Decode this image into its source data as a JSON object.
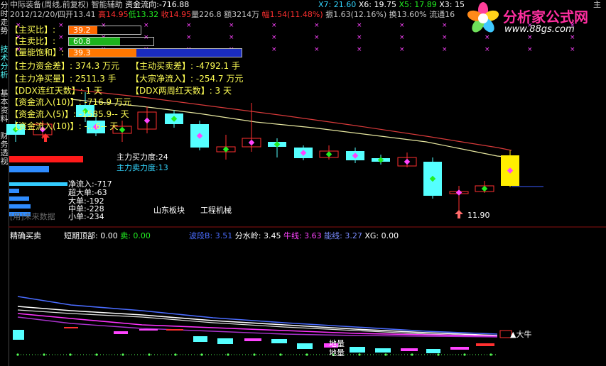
{
  "sidebar": {
    "tabs": [
      {
        "label": "分时走势"
      },
      {
        "label": "技术分析"
      },
      {
        "label": "基本资料"
      },
      {
        "label": "财务透视"
      }
    ]
  },
  "header": {
    "title": "中际装备(周线,前复权)",
    "indicator": "智能辅助",
    "flow_label": "资金流向:",
    "flow_value": "-716.88",
    "x7": "X7: 21.60",
    "x6": "X6: 19.75",
    "x5": "X5: 17.89",
    "x3": "X3: 15",
    "date": "2012/12/20/四",
    "open": "开13.41",
    "high": "高14.95",
    "low": "低13.32",
    "close": "收14.95",
    "volume": "量226.8",
    "amount": "额3214万",
    "change": "幅1.54(11.48%)",
    "amplitude": "振1.63(12.16%)",
    "turnover": "换13.60%",
    "float": "流通16",
    "right_note": "主"
  },
  "watermark": {
    "brand": "分析家公式网",
    "url": "www.88gs.com"
  },
  "ratio_bars": [
    {
      "label": "【主买比】:",
      "value": "39.2",
      "fill": 0.392,
      "color": "#ff6a00"
    },
    {
      "label": "【主卖比】:",
      "value": "60.8",
      "fill": 0.608,
      "color": "#1db31d"
    },
    {
      "label": "【量能饱和】:",
      "value": "39.3",
      "fill": 0.393,
      "color": "#ff7700",
      "rest_color": "#1a2cbf"
    }
  ],
  "stats": {
    "main_fund_diff": "【主力资金差】: 374.3 万元",
    "active_buy_diff": "【主动买卖差】: -4792.1 手",
    "main_net_buy": "【主力净买量】: 2511.3 手",
    "block_net_inflow": "【大宗净流入】: -254.7 万元",
    "ddx_red_days": "【DDX连红天数】: 1 天",
    "ddx_two_week": "【DDX两周红天数】: 3 天",
    "inflow_10_1": "【资金流入(10)】: -716.9 万元",
    "inflow_5": "【资金流入(5)】: -1585.9-- 天",
    "inflow_10_2": "【资金流入(10)】: -...6-- 天"
  },
  "power": {
    "buy": "主力买力度:24",
    "sell": "主力卖力度:13",
    "buy_fill": 0.24,
    "sell_fill": 0.13
  },
  "order_flow": {
    "net": "净流入:-717",
    "super": "超大单:-63",
    "large": "大单:-192",
    "medium": "中单:-228",
    "small": "小单:-234",
    "future": "[用]未来数据"
  },
  "tags": {
    "sector": "山东板块",
    "industry": "工程机械",
    "low_price": "11.90"
  },
  "lower_panel": {
    "title": "精确买卖",
    "short_top": "短期顶部: 0.00",
    "sell": "卖: 0.00",
    "wave_b": "波段B: 3.51",
    "watershed": "分水岭: 3.45",
    "bull_line": "牛线: 3.63",
    "energy_line": "能线: 3.27",
    "xg": "XG: 0.00",
    "bull_tag": "▲大牛",
    "ground1": "地量",
    "ground2": "地量"
  },
  "colors": {
    "bull": "#ff3030",
    "bear": "#55ffff",
    "ma_red": "#d83a3a",
    "ma_yellow": "#e8e8a0",
    "blue_line": "#4a6cff",
    "white_line": "#ffffff",
    "magenta_line": "#ff33ff",
    "purple_line": "#aa33cc"
  }
}
